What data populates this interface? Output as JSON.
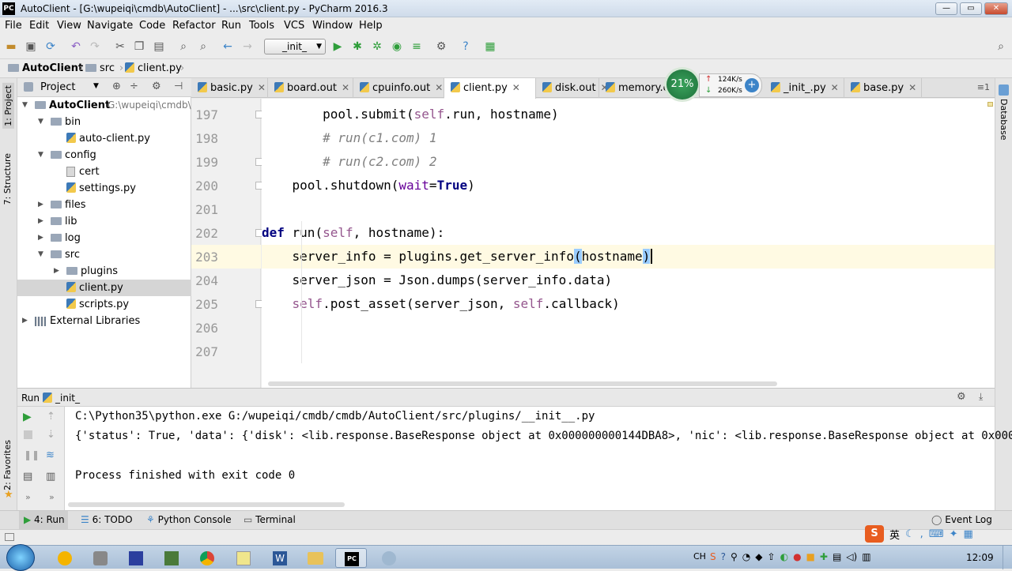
{
  "window": {
    "title": "AutoClient - [G:\\wupeiqi\\cmdb\\AutoClient] - ...\\src\\client.py - PyCharm 2016.3",
    "app_icon": "PC",
    "minimize": "—",
    "maximize": "▭",
    "close": "✕"
  },
  "menu": [
    "File",
    "Edit",
    "View",
    "Navigate",
    "Code",
    "Refactor",
    "Run",
    "Tools",
    "VCS",
    "Window",
    "Help"
  ],
  "toolbar": {
    "run_config": "_init_"
  },
  "breadcrumb": [
    "AutoClient",
    "src",
    "client.py"
  ],
  "left_stripe": {
    "project_tab": "1: Project",
    "structure_tab": "7: Structure",
    "favorites_tab": "2: Favorites"
  },
  "right_stripe": {
    "database_tab": "Database"
  },
  "project_panel": {
    "header_label": "Project",
    "root_label": "AutoClient",
    "root_path": "G:\\wupeiqi\\cmdb\\",
    "tree": [
      {
        "label": "bin",
        "kind": "folder",
        "depth": 1,
        "expanded": true
      },
      {
        "label": "auto-client.py",
        "kind": "py",
        "depth": 2
      },
      {
        "label": "config",
        "kind": "folder",
        "depth": 1,
        "expanded": true
      },
      {
        "label": "cert",
        "kind": "file",
        "depth": 2
      },
      {
        "label": "settings.py",
        "kind": "py",
        "depth": 2
      },
      {
        "label": "files",
        "kind": "folder",
        "depth": 1,
        "expanded": false
      },
      {
        "label": "lib",
        "kind": "folder",
        "depth": 1,
        "expanded": false
      },
      {
        "label": "log",
        "kind": "folder",
        "depth": 1,
        "expanded": false
      },
      {
        "label": "src",
        "kind": "folder",
        "depth": 1,
        "expanded": true
      },
      {
        "label": "plugins",
        "kind": "folder",
        "depth": 2,
        "expanded": false
      },
      {
        "label": "client.py",
        "kind": "py",
        "depth": 2,
        "selected": true
      },
      {
        "label": "scripts.py",
        "kind": "py",
        "depth": 2
      }
    ],
    "external_libraries": "External Libraries"
  },
  "editor_tabs": [
    {
      "label": "basic.py"
    },
    {
      "label": "board.out"
    },
    {
      "label": "cpuinfo.out"
    },
    {
      "label": "client.py",
      "active": true
    },
    {
      "label": "disk.out"
    },
    {
      "label": "memory.o"
    },
    {
      "label": "_init_.py"
    },
    {
      "label": "base.py"
    }
  ],
  "tabs_overflow": "≡1",
  "net_widget": {
    "cpu_percent": "21%",
    "up_speed": "124K/s",
    "down_speed": "260K/s"
  },
  "editor": {
    "line_numbers": [
      "197",
      "198",
      "199",
      "200",
      "201",
      "202",
      "203",
      "204",
      "205",
      "206",
      "207"
    ],
    "highlight_line": "203"
  },
  "run_panel": {
    "header_label": "Run",
    "config_name": "_init_",
    "lines": [
      "C:\\Python35\\python.exe G:/wupeiqi/cmdb/cmdb/AutoClient/src/plugins/__init__.py",
      "{'status': True, 'data': {'disk': <lib.response.BaseResponse object at 0x000000000144DBA8>, 'nic': <lib.response.BaseResponse object at 0x0000000",
      "",
      "Process finished with exit code 0"
    ]
  },
  "bottom_tabs": [
    {
      "label": "4: Run",
      "underline": "4"
    },
    {
      "label": "6: TODO",
      "underline": "6"
    },
    {
      "label": "Python Console"
    },
    {
      "label": "Terminal"
    }
  ],
  "event_log": "Event Log",
  "taskbar": {
    "clock": "12:09",
    "ime": "英",
    "lang": "CH"
  }
}
